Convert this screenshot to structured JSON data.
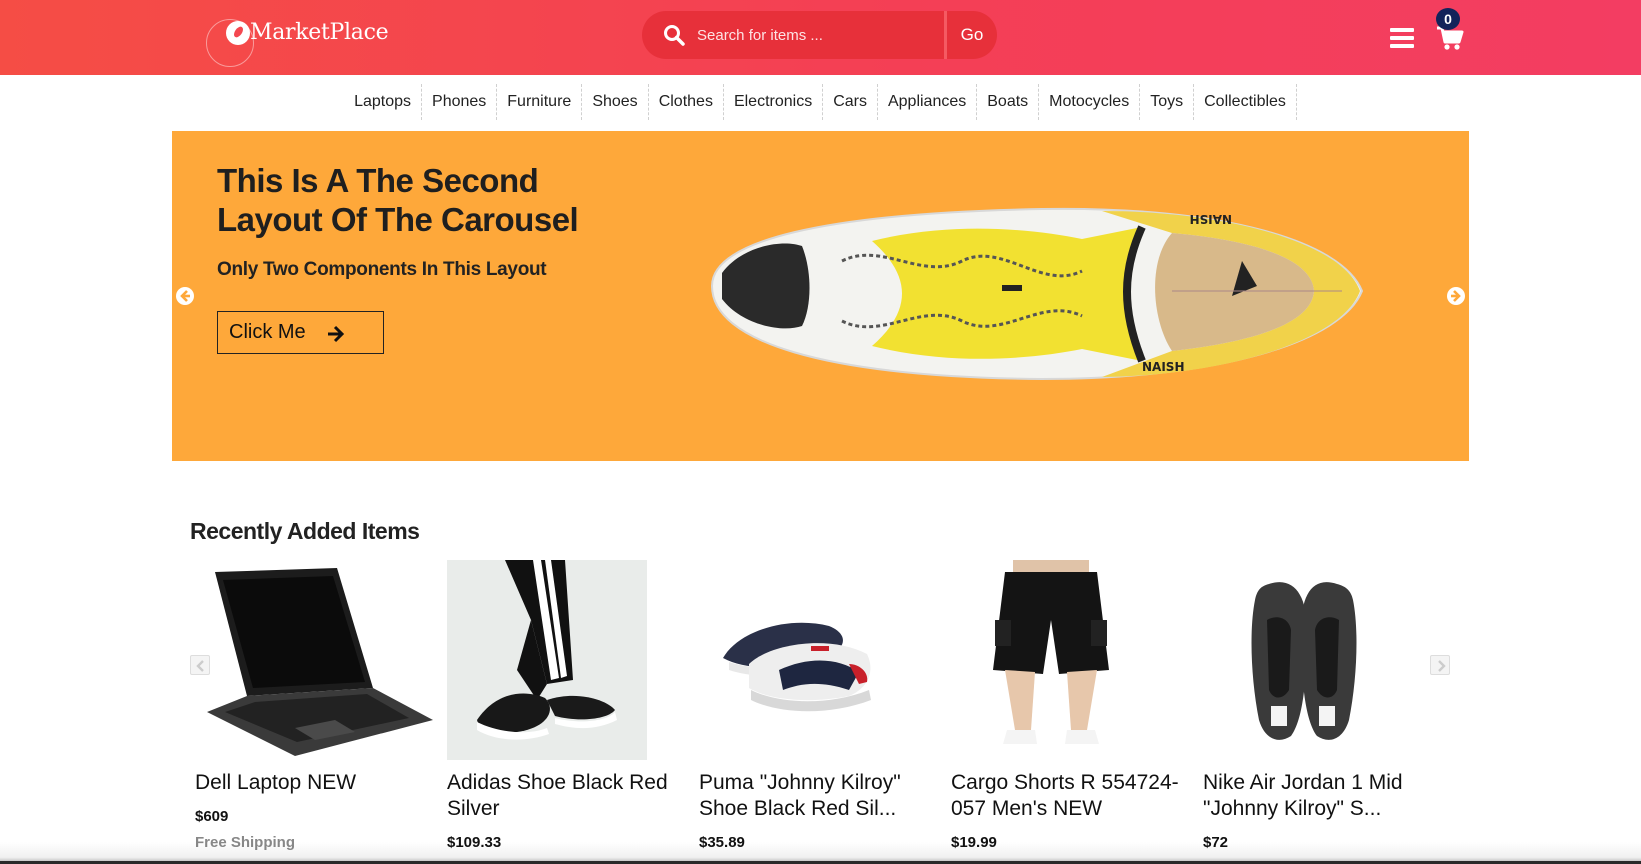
{
  "header": {
    "logo_text": "MarketPlace",
    "search_placeholder": "Search for items ...",
    "go_label": "Go",
    "cart_count": "0"
  },
  "categories": [
    "Laptops",
    "Phones",
    "Furniture",
    "Shoes",
    "Clothes",
    "Electronics",
    "Cars",
    "Appliances",
    "Boats",
    "Motocycles",
    "Toys",
    "Collectibles"
  ],
  "hero": {
    "title": "This Is A The Second Layout Of The Carousel",
    "subtitle": "Only Two Components In This Layout",
    "button_label": "Click Me",
    "board_brand": "NAISH"
  },
  "recent": {
    "title": "Recently Added Items",
    "items": [
      {
        "name": "Dell Laptop NEW",
        "price": "$609",
        "shipping": "Free Shipping"
      },
      {
        "name": "Adidas Shoe Black Red Silver",
        "price": "$109.33"
      },
      {
        "name": "Puma \"Johnny Kilroy\" Shoe Black Red Sil...",
        "price": "$35.89"
      },
      {
        "name": "Cargo Shorts R 554724-057 Men's NEW",
        "price": "$19.99"
      },
      {
        "name": "Nike Air Jordan 1 Mid \"Johnny Kilroy\" S...",
        "price": "$72"
      }
    ]
  },
  "colors": {
    "header_start": "#f54d45",
    "header_end": "#f33d62",
    "hero_bg": "#fea83a",
    "badge": "#12235a"
  }
}
